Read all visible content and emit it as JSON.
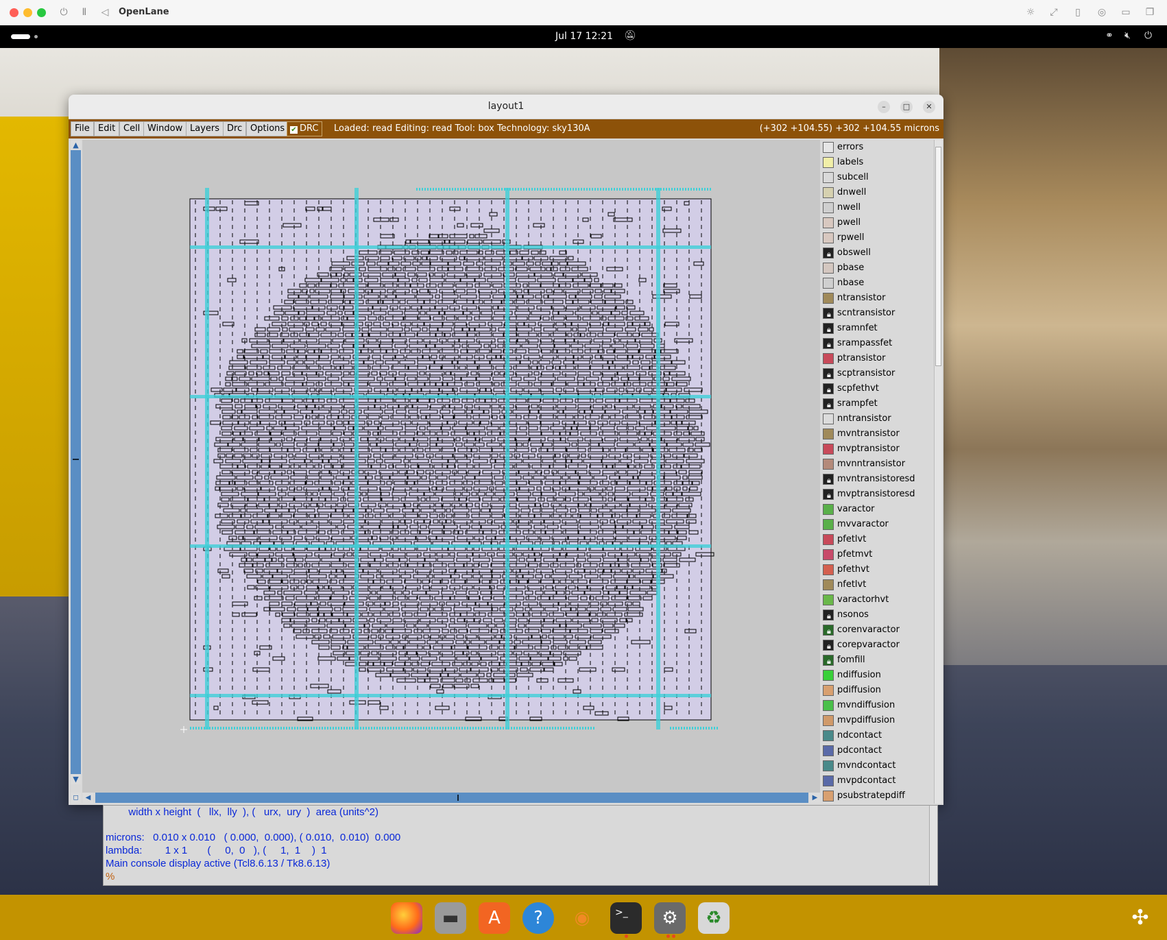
{
  "host": {
    "title": "OpenLane"
  },
  "topbar": {
    "clock": "Jul 17  12:21"
  },
  "window": {
    "title": "layout1",
    "menus": [
      "File",
      "Edit",
      "Cell",
      "Window",
      "Layers",
      "Drc",
      "Options"
    ],
    "drc_label": "DRC",
    "drc_checked": true,
    "status": "Loaded: read  Editing: read  Tool: box   Technology: sky130A",
    "coords": "(+302 +104.55) +302 +104.55 microns"
  },
  "layers": [
    {
      "name": "errors",
      "color": "#e6e6e6",
      "locked": false
    },
    {
      "name": "labels",
      "color": "#f1efa8",
      "locked": false
    },
    {
      "name": "subcell",
      "color": "#d9d9d9",
      "locked": false
    },
    {
      "name": "dnwell",
      "color": "#d6d1b0",
      "locked": false
    },
    {
      "name": "nwell",
      "color": "#cfcfcf",
      "locked": false
    },
    {
      "name": "pwell",
      "color": "#d8c8c0",
      "locked": false
    },
    {
      "name": "rpwell",
      "color": "#d8c8c0",
      "locked": false
    },
    {
      "name": "obswell",
      "color": "#222222",
      "locked": true
    },
    {
      "name": "pbase",
      "color": "#d4c7c0",
      "locked": false
    },
    {
      "name": "nbase",
      "color": "#cfcfcf",
      "locked": false
    },
    {
      "name": "ntransistor",
      "color": "#a08a5a",
      "locked": false
    },
    {
      "name": "scntransistor",
      "color": "#222222",
      "locked": true
    },
    {
      "name": "sramnfet",
      "color": "#222222",
      "locked": true
    },
    {
      "name": "srampassfet",
      "color": "#222222",
      "locked": true
    },
    {
      "name": "ptransistor",
      "color": "#c84a5a",
      "locked": false
    },
    {
      "name": "scptransistor",
      "color": "#222222",
      "locked": true
    },
    {
      "name": "scpfethvt",
      "color": "#222222",
      "locked": true
    },
    {
      "name": "srampfet",
      "color": "#222222",
      "locked": true
    },
    {
      "name": "nntransistor",
      "color": "#dcdcdc",
      "locked": false
    },
    {
      "name": "mvntransistor",
      "color": "#a08a5a",
      "locked": false
    },
    {
      "name": "mvptransistor",
      "color": "#c84a5a",
      "locked": false
    },
    {
      "name": "mvnntransistor",
      "color": "#b48a7a",
      "locked": false
    },
    {
      "name": "mvntransistoresd",
      "color": "#222222",
      "locked": true
    },
    {
      "name": "mvptransistoresd",
      "color": "#222222",
      "locked": true
    },
    {
      "name": "varactor",
      "color": "#5ab04a",
      "locked": false
    },
    {
      "name": "mvvaractor",
      "color": "#5ab04a",
      "locked": false
    },
    {
      "name": "pfetlvt",
      "color": "#c84a5a",
      "locked": false
    },
    {
      "name": "pfetmvt",
      "color": "#c84a6a",
      "locked": false
    },
    {
      "name": "pfethvt",
      "color": "#d46050",
      "locked": false
    },
    {
      "name": "nfetlvt",
      "color": "#a08a5a",
      "locked": false
    },
    {
      "name": "varactorhvt",
      "color": "#6ab84a",
      "locked": false
    },
    {
      "name": "nsonos",
      "color": "#222222",
      "locked": true
    },
    {
      "name": "corenvaractor",
      "color": "#2a6a2a",
      "locked": true
    },
    {
      "name": "corepvaractor",
      "color": "#222222",
      "locked": true
    },
    {
      "name": "fomfill",
      "color": "#2a6a2a",
      "locked": true
    },
    {
      "name": "ndiffusion",
      "color": "#3ad03a",
      "locked": false
    },
    {
      "name": "pdiffusion",
      "color": "#d8a070",
      "locked": false
    },
    {
      "name": "mvndiffusion",
      "color": "#4ac04a",
      "locked": false
    },
    {
      "name": "mvpdiffusion",
      "color": "#d09a6a",
      "locked": false
    },
    {
      "name": "ndcontact",
      "color": "#4a8a8a",
      "locked": false
    },
    {
      "name": "pdcontact",
      "color": "#5a6aa8",
      "locked": false
    },
    {
      "name": "mvndcontact",
      "color": "#4a8a8a",
      "locked": false
    },
    {
      "name": "mvpdcontact",
      "color": "#5a6aa8",
      "locked": false
    },
    {
      "name": "psubstratepdiff",
      "color": "#d8a070",
      "locked": false
    }
  ],
  "console": {
    "lines": [
      "        width x height  (   llx,  lly  ), (   urx,  ury  )  area (units^2)",
      "",
      "microns:   0.010 x 0.010   ( 0.000,  0.000), ( 0.010,  0.010)  0.000",
      "lambda:        1 x 1       (     0,  0   ), (     1,  1    )  1",
      "Main console display active (Tcl8.6.13 / Tk8.6.13)",
      "%"
    ]
  },
  "dock": {
    "items": [
      "firefox-icon",
      "files-icon",
      "app-center-icon",
      "help-icon",
      "blender-icon",
      "terminal-icon",
      "settings-icon",
      "trash-icon"
    ]
  },
  "colors": {
    "menubar": "#8d5209",
    "scroll": "#5a8ec4",
    "canvas": "#c7c7c7",
    "cell_fill": "#d2cde6",
    "route": "#3ed0d8",
    "console_text": "#0a28d8"
  }
}
